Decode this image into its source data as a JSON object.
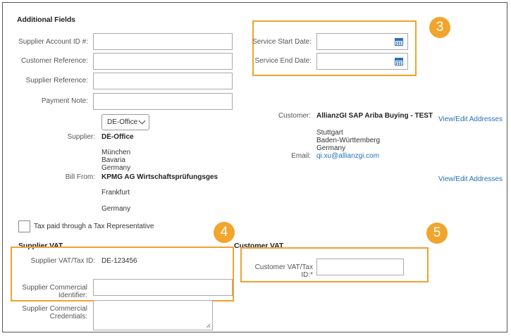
{
  "additional_fields": {
    "title": "Additional Fields",
    "supplier_account_id_label": "Supplier Account ID #:",
    "customer_reference_label": "Customer Reference:",
    "supplier_reference_label": "Supplier Reference:",
    "payment_note_label": "Payment Note:",
    "service_start_date_label": "Service Start Date:",
    "service_end_date_label": "Service End Date:"
  },
  "supplier": {
    "select_value": "DE-Office",
    "label": "Supplier:",
    "name": "DE-Office",
    "address_lines": [
      "München",
      "Bavaria",
      "Germany"
    ],
    "bill_from_label": "Bill From:",
    "bill_from_name": "KPMG AG Wirtschaftsprüfungsges",
    "bill_from_city": "Frankfurt",
    "bill_from_country": "Germany"
  },
  "customer": {
    "label": "Customer:",
    "name": "AllianzGI SAP Ariba Buying - TEST",
    "address_lines": [
      "Stuttgart",
      "Baden-Württemberg",
      "Germany"
    ],
    "email_label": "Email:",
    "email": "qi.xu@allianzgi.com"
  },
  "links": {
    "view_edit_addresses_1": "View/Edit Addresses",
    "view_edit_addresses_2": "View/Edit Addresses"
  },
  "tax_rep": {
    "checkbox_label": "Tax paid through a Tax Representative"
  },
  "supplier_vat": {
    "title": "Supplier VAT",
    "vat_id_label": "Supplier VAT/Tax ID:",
    "vat_id_value": "DE-123456",
    "commercial_identifier_label_1": "Supplier Commercial",
    "commercial_identifier_label_2": "Identifier:",
    "commercial_credentials_label_1": "Supplier Commercial",
    "commercial_credentials_label_2": "Credentials:"
  },
  "customer_vat": {
    "title": "Customer VAT",
    "vat_id_label": "Customer VAT/Tax ID:*"
  },
  "badges": {
    "three": "3",
    "four": "4",
    "five": "5"
  },
  "colors": {
    "highlight": "#f0a22e",
    "badge": "#f1a52c",
    "link": "#2570b8"
  }
}
